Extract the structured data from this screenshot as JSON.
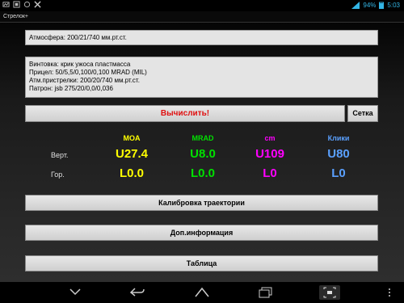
{
  "status": {
    "battery": "94%",
    "time": "5:03"
  },
  "title": "Стрелок+",
  "info": {
    "atmosphere": "Атмосфера: 200/21/740 мм.рт.ст.",
    "lines": [
      "Винтовка: крик ужоса пластмасса",
      "Прицел: 50/5,5/0,100/0,100 MRAD (MIL)",
      "Атм.пристрелки: 200/20/740 мм.рт.ст.",
      "Патрон: jsb 275/20/0,0/0,036"
    ]
  },
  "buttons": {
    "calculate": "Вычислить!",
    "grid": "Сетка",
    "trajectory": "Калибровка траектории",
    "extra": "Доп.информация",
    "table": "Таблица"
  },
  "results": {
    "headers": [
      "MOA",
      "MRAD",
      "cm",
      "Клики"
    ],
    "header_colors": [
      "#ffff00",
      "#00e000",
      "#ff00ff",
      "#5aa0ff"
    ],
    "vertical_label": "Верт.",
    "horizontal_label": "Гор.",
    "vertical": [
      "U27.4",
      "U8.0",
      "U109",
      "U80"
    ],
    "horizontal": [
      "L0.0",
      "L0.0",
      "L0",
      "L0"
    ]
  },
  "icons": {
    "status_left": [
      "image-icon",
      "gallery-icon",
      "sync-icon",
      "tools-icon"
    ],
    "nav": [
      "hide-keyboard-icon",
      "back-icon",
      "home-icon",
      "recent-apps-icon",
      "screenshot-icon",
      "menu-icon"
    ]
  }
}
